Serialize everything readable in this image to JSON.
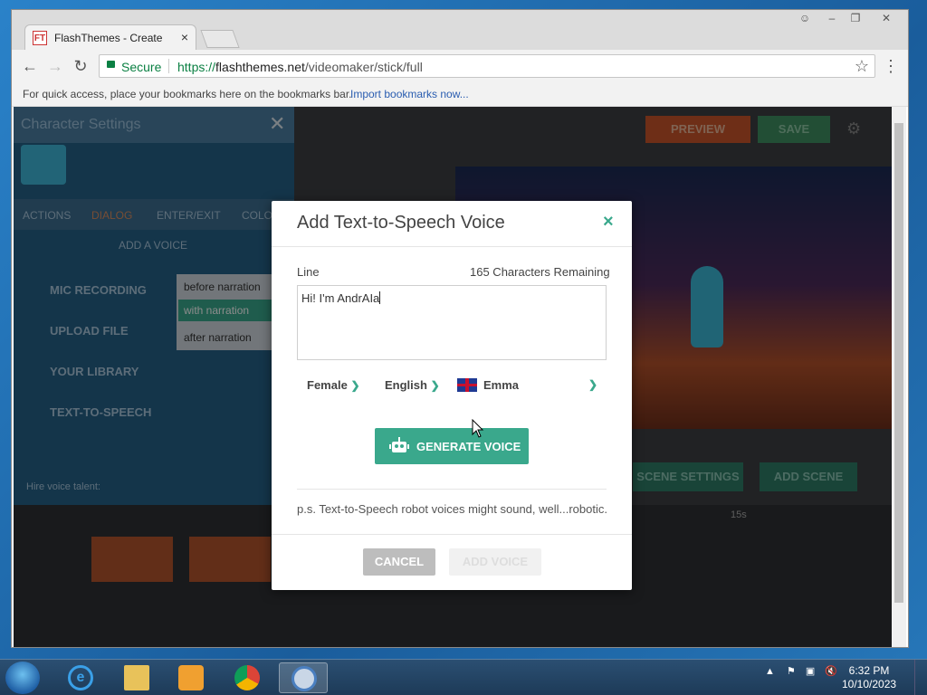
{
  "browser": {
    "tab_title": "FlashThemes - Create",
    "tab_close": "×",
    "favicon_text": "FT",
    "secure_label": "Secure",
    "url_scheme": "https://",
    "url_domain": "flashthemes.net",
    "url_path": "/videomaker/stick/full",
    "bookmarks_prompt": "For quick access, place your bookmarks here on the bookmarks bar.",
    "import_link": "Import bookmarks now..."
  },
  "background_app": {
    "panel_title": "Character Settings",
    "tabs": [
      "ACTIONS",
      "DIALOG",
      "ENTER/EXIT",
      "COLO"
    ],
    "add_voice": "ADD A VOICE",
    "voice_options": [
      "MIC RECORDING",
      "UPLOAD FILE",
      "YOUR LIBRARY",
      "TEXT-TO-SPEECH"
    ],
    "narration": [
      "before narration",
      "with narration",
      "after narration"
    ],
    "preview_label": "PREVIEW",
    "save_label": "SAVE",
    "scene_settings": "SCENE SETTINGS",
    "add_scene": "ADD SCENE",
    "hire_label": "Hire voice talent:",
    "timeline_marker": "15s"
  },
  "modal": {
    "title": "Add Text-to-Speech Voice",
    "close": "×",
    "line_label": "Line",
    "remaining": "165 Characters Remaining",
    "line_value": "Hi! I'm AndrAIa",
    "gender": "Female",
    "language": "English",
    "voice": "Emma",
    "generate_label": "GENERATE VOICE",
    "note": "p.s. Text-to-Speech robot voices might sound, well...robotic.",
    "cancel_label": "CANCEL",
    "add_voice_label": "ADD VOICE"
  },
  "taskbar": {
    "time": "6:32 PM",
    "date": "10/10/2023"
  },
  "colors": {
    "accent": "#3aa88c",
    "secure": "#0b8043"
  }
}
